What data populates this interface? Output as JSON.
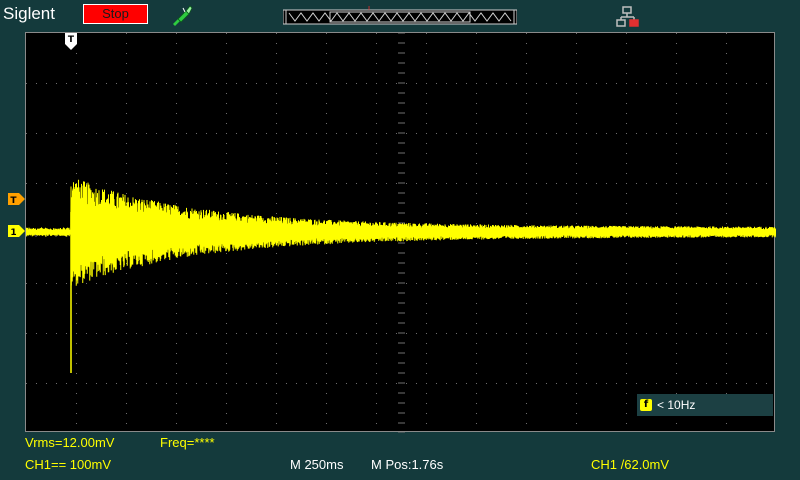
{
  "header": {
    "brand": "Siglent",
    "run_state_label": "Stop",
    "run_state_color": "#ff0000",
    "trigger_position_marker": "T"
  },
  "icons": {
    "probe": "probe-icon",
    "network": "network-icon"
  },
  "colors": {
    "channel1": "#ffff00",
    "trigger_marker": "#ffa000",
    "background": "#143a3c",
    "screen": "#000000"
  },
  "screen": {
    "trigger_time_marker": "T",
    "ch1_trigger_level_marker": "T",
    "ch1_ground_marker": "1"
  },
  "freq_counter": {
    "icon": "f",
    "label": "< 10Hz"
  },
  "measurements": {
    "vrms": "Vrms=12.00mV",
    "freq": "Freq=****"
  },
  "status_bar": {
    "ch1_scale": "CH1== 100mV",
    "timebase": "M 250ms",
    "position": "M Pos:1.76s",
    "trigger": "CH1 /62.0mV"
  }
}
